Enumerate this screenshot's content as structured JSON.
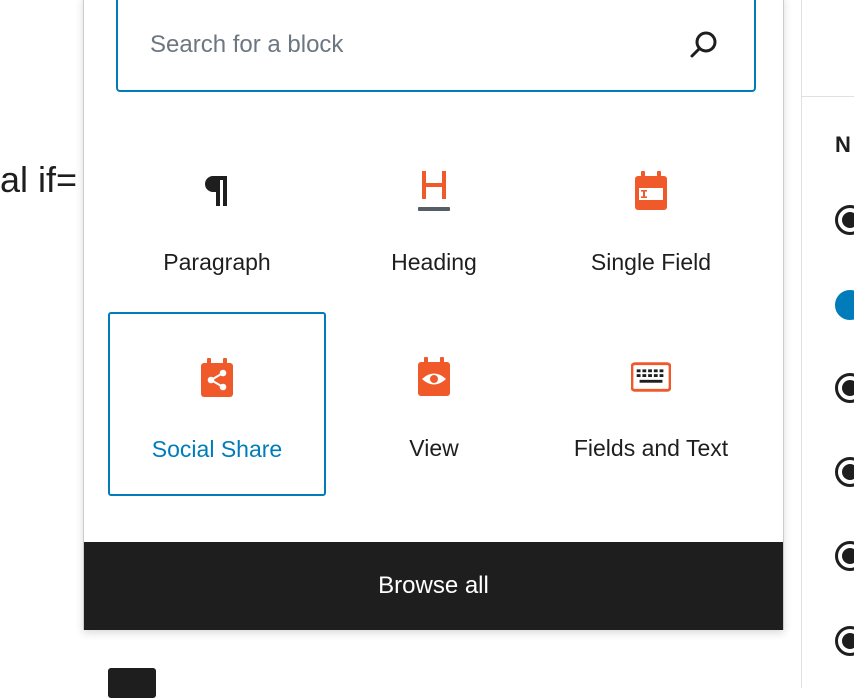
{
  "editor": {
    "background_text": "al if=",
    "sidebar_heading_letter": "N"
  },
  "inserter": {
    "search": {
      "placeholder": "Search for a block",
      "value": ""
    },
    "blocks": [
      {
        "label": "Paragraph",
        "icon": "paragraph-icon"
      },
      {
        "label": "Heading",
        "icon": "heading-icon"
      },
      {
        "label": "Single Field",
        "icon": "single-field-icon"
      },
      {
        "label": "Social Share",
        "icon": "share-icon",
        "selected": true
      },
      {
        "label": "View",
        "icon": "view-eye-icon"
      },
      {
        "label": "Fields and Text",
        "icon": "keyboard-icon"
      }
    ],
    "browse_all_label": "Browse all"
  },
  "colors": {
    "accent": "#007cba",
    "brand_orange": "#f05a2b",
    "dark": "#1e1e1e"
  }
}
